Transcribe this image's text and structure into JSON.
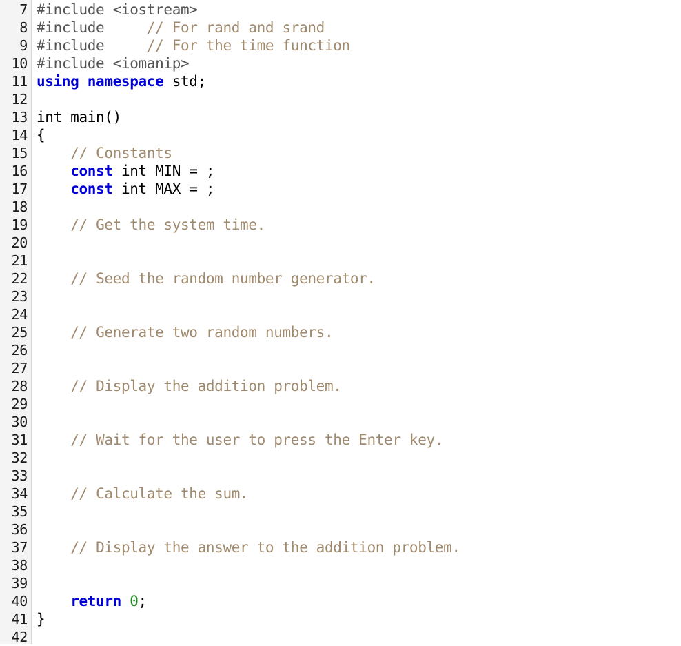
{
  "editor": {
    "language": "cpp",
    "first_line_number": 7,
    "last_line_number": 42,
    "colors": {
      "background": "#ffffff",
      "gutter_background": "#f4f4f4",
      "gutter_border": "#d6d6d6",
      "line_number": "#1a1a1a",
      "keyword": "#0000d6",
      "comment": "#a08a6e",
      "preprocessor": "#555555",
      "plain": "#000000",
      "number": "#1e8b1e"
    }
  },
  "lines": [
    {
      "number": "7",
      "tokens": [
        {
          "t": "#include <iostream>",
          "c": "preproc"
        }
      ]
    },
    {
      "number": "8",
      "tokens": [
        {
          "t": "#include     ",
          "c": "preproc"
        },
        {
          "t": "// For rand and srand",
          "c": "comment"
        }
      ]
    },
    {
      "number": "9",
      "tokens": [
        {
          "t": "#include     ",
          "c": "preproc"
        },
        {
          "t": "// For the time function",
          "c": "comment"
        }
      ]
    },
    {
      "number": "10",
      "tokens": [
        {
          "t": "#include <iomanip>",
          "c": "preproc"
        }
      ]
    },
    {
      "number": "11",
      "tokens": [
        {
          "t": "using namespace",
          "c": "keyword"
        },
        {
          "t": " std;",
          "c": "plain"
        }
      ]
    },
    {
      "number": "12",
      "tokens": []
    },
    {
      "number": "13",
      "tokens": [
        {
          "t": "int main()",
          "c": "plain"
        }
      ]
    },
    {
      "number": "14",
      "tokens": [
        {
          "t": "{",
          "c": "plain"
        }
      ]
    },
    {
      "number": "15",
      "tokens": [
        {
          "t": "    ",
          "c": "plain"
        },
        {
          "t": "// Constants",
          "c": "comment"
        }
      ]
    },
    {
      "number": "16",
      "tokens": [
        {
          "t": "    ",
          "c": "plain"
        },
        {
          "t": "const",
          "c": "keyword"
        },
        {
          "t": " int MIN = ;",
          "c": "plain"
        }
      ]
    },
    {
      "number": "17",
      "tokens": [
        {
          "t": "    ",
          "c": "plain"
        },
        {
          "t": "const",
          "c": "keyword"
        },
        {
          "t": " int MAX = ;",
          "c": "plain"
        }
      ]
    },
    {
      "number": "18",
      "tokens": []
    },
    {
      "number": "19",
      "tokens": [
        {
          "t": "    ",
          "c": "plain"
        },
        {
          "t": "// Get the system time.",
          "c": "comment"
        }
      ]
    },
    {
      "number": "20",
      "tokens": []
    },
    {
      "number": "21",
      "tokens": []
    },
    {
      "number": "22",
      "tokens": [
        {
          "t": "    ",
          "c": "plain"
        },
        {
          "t": "// Seed the random number generator.",
          "c": "comment"
        }
      ]
    },
    {
      "number": "23",
      "tokens": []
    },
    {
      "number": "24",
      "tokens": []
    },
    {
      "number": "25",
      "tokens": [
        {
          "t": "    ",
          "c": "plain"
        },
        {
          "t": "// Generate two random numbers.",
          "c": "comment"
        }
      ]
    },
    {
      "number": "26",
      "tokens": []
    },
    {
      "number": "27",
      "tokens": []
    },
    {
      "number": "28",
      "tokens": [
        {
          "t": "    ",
          "c": "plain"
        },
        {
          "t": "// Display the addition problem.",
          "c": "comment"
        }
      ]
    },
    {
      "number": "29",
      "tokens": []
    },
    {
      "number": "30",
      "tokens": []
    },
    {
      "number": "31",
      "tokens": [
        {
          "t": "    ",
          "c": "plain"
        },
        {
          "t": "// Wait for the user to press the Enter key.",
          "c": "comment"
        }
      ]
    },
    {
      "number": "32",
      "tokens": []
    },
    {
      "number": "33",
      "tokens": []
    },
    {
      "number": "34",
      "tokens": [
        {
          "t": "    ",
          "c": "plain"
        },
        {
          "t": "// Calculate the sum.",
          "c": "comment"
        }
      ]
    },
    {
      "number": "35",
      "tokens": []
    },
    {
      "number": "36",
      "tokens": []
    },
    {
      "number": "37",
      "tokens": [
        {
          "t": "    ",
          "c": "plain"
        },
        {
          "t": "// Display the answer to the addition problem.",
          "c": "comment"
        }
      ]
    },
    {
      "number": "38",
      "tokens": []
    },
    {
      "number": "39",
      "tokens": []
    },
    {
      "number": "40",
      "tokens": [
        {
          "t": "    ",
          "c": "plain"
        },
        {
          "t": "return",
          "c": "keyword"
        },
        {
          "t": " ",
          "c": "plain"
        },
        {
          "t": "0",
          "c": "number"
        },
        {
          "t": ";",
          "c": "plain"
        }
      ]
    },
    {
      "number": "41",
      "tokens": [
        {
          "t": "}",
          "c": "plain"
        }
      ]
    },
    {
      "number": "42",
      "tokens": []
    }
  ]
}
